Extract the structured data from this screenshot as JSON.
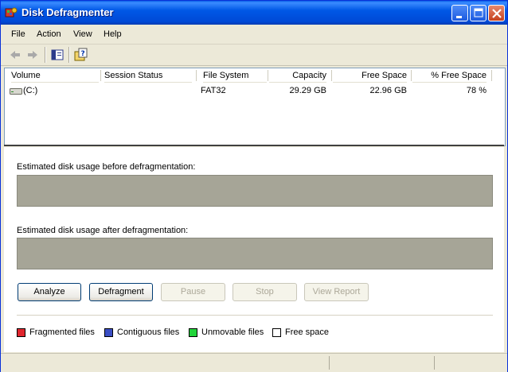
{
  "window": {
    "title": "Disk Defragmenter"
  },
  "menu": {
    "items": [
      "File",
      "Action",
      "View",
      "Help"
    ]
  },
  "toolbar": {
    "icons": [
      "back-arrow-icon",
      "forward-arrow-icon",
      "show-hide-console-tree-icon",
      "help-icon"
    ]
  },
  "volumes": {
    "headers": [
      "Volume",
      "Session Status",
      "File System",
      "Capacity",
      "Free Space",
      "% Free Space"
    ],
    "rows": [
      {
        "volume": "(C:)",
        "session_status": "",
        "file_system": "FAT32",
        "capacity": "29.29 GB",
        "free_space": "22.96 GB",
        "percent_free": "78 %"
      }
    ]
  },
  "analysis": {
    "before_label": "Estimated disk usage before defragmentation:",
    "after_label": "Estimated disk usage after defragmentation:"
  },
  "buttons": {
    "analyze": "Analyze",
    "defragment": "Defragment",
    "pause": "Pause",
    "stop": "Stop",
    "view_report": "View Report"
  },
  "legend": [
    {
      "label": "Fragmented files",
      "color": "#e0262e"
    },
    {
      "label": "Contiguous files",
      "color": "#3a4ec4"
    },
    {
      "label": "Unmovable files",
      "color": "#22d43a"
    },
    {
      "label": "Free space",
      "color": "#ffffff"
    }
  ],
  "colors": {
    "titlebar": "#0054e3",
    "usage_bar": "#a6a597"
  }
}
